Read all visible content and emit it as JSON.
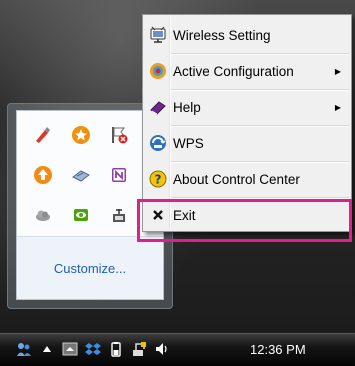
{
  "context_menu": {
    "items": [
      {
        "label": "Wireless Setting",
        "icon": "wireless-setting-icon",
        "submenu": false
      },
      {
        "label": "Active Configuration",
        "icon": "active-configuration-icon",
        "submenu": true
      },
      {
        "label": "Help",
        "icon": "help-book-icon",
        "submenu": true
      },
      {
        "label": "WPS",
        "icon": "wps-icon",
        "submenu": false
      },
      {
        "label": "About Control Center",
        "icon": "about-question-icon",
        "submenu": false
      },
      {
        "label": "Exit",
        "icon": "close-x-icon",
        "submenu": false
      }
    ]
  },
  "tray_flyout": {
    "icons": [
      "pen-tool-icon",
      "orange-star-icon",
      "flag-warning-icon",
      "orange-up-arrow-icon",
      "network-adapter-icon",
      "onenote-icon",
      "cloud-icon",
      "nvidia-icon",
      "wireless-utility-icon"
    ],
    "customize_label": "Customize..."
  },
  "taskbar": {
    "clock": "12:36 PM"
  },
  "colors": {
    "highlight": "#e21e8e",
    "link": "#1e5fb0"
  }
}
